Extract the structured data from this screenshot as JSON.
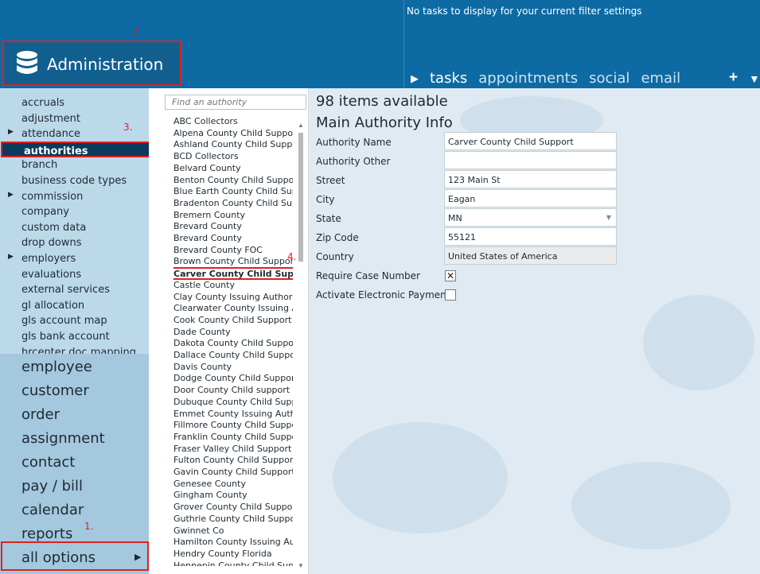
{
  "header": {
    "module_title": "Administration",
    "tasks_message": "No tasks to display for your current filter settings",
    "tabs": [
      "tasks",
      "appointments",
      "social",
      "email"
    ],
    "plus_label": "+",
    "caret_label": "▼",
    "play_label": "▶"
  },
  "annotations": {
    "n1": "1.",
    "n2": "2.",
    "n3": "3.",
    "n4": "4."
  },
  "sidebar": {
    "sub_items": [
      {
        "label": "accruals",
        "arrow": ""
      },
      {
        "label": "adjustment",
        "arrow": ""
      },
      {
        "label": "attendance",
        "arrow": "▶"
      },
      {
        "label": "authorities",
        "arrow": ""
      },
      {
        "label": "branch",
        "arrow": ""
      },
      {
        "label": "business code types",
        "arrow": ""
      },
      {
        "label": "commission",
        "arrow": "▶"
      },
      {
        "label": "company",
        "arrow": ""
      },
      {
        "label": "custom data",
        "arrow": ""
      },
      {
        "label": "drop downs",
        "arrow": ""
      },
      {
        "label": "employers",
        "arrow": "▶"
      },
      {
        "label": "evaluations",
        "arrow": ""
      },
      {
        "label": "external services",
        "arrow": ""
      },
      {
        "label": "gl allocation",
        "arrow": ""
      },
      {
        "label": "gls account map",
        "arrow": ""
      },
      {
        "label": "gls bank account",
        "arrow": ""
      },
      {
        "label": "hrcenter doc mapping",
        "arrow": ""
      }
    ],
    "selected_sub_item": "authorities",
    "main_nav": [
      "employee",
      "customer",
      "order",
      "assignment",
      "contact",
      "pay / bill",
      "calendar",
      "reports"
    ],
    "all_options": "all options",
    "all_options_arrow": "▶"
  },
  "list": {
    "search_placeholder": "Find an authority",
    "items": [
      "ABC Collectors",
      "Alpena County Child Support",
      "Ashland County Child Support",
      "BCD Collectors",
      "Belvard County",
      "Benton County Child Support",
      "Blue Earth County Child Support",
      "Bradenton County Child Support",
      "Bremern County",
      "Brevard County",
      "Brevard County",
      "Brevard County FOC",
      "Brown County Child Support",
      "Carver County Child Support",
      "Castle County",
      "Clay County Issuing Authority",
      "Clearwater County Issuing Authority",
      "Cook County Child Support Agency",
      "Dade County",
      "Dakota County Child Support Agency",
      "Dallace County Child Support",
      "Davis County",
      "Dodge County Child Support",
      "Door County Child support",
      "Dubuque County Child Support",
      "Emmet County Issuing Authority",
      "Fillmore County Child Support",
      "Franklin County Child Support",
      "Fraser Valley Child Support",
      "Fulton County Child Support",
      "Gavin County Child Support",
      "Genesee County",
      "Gingham County",
      "Grover County Child Support",
      "Guthrie County Child Support",
      "Gwinnet Co",
      "Hamilton County Issuing Authority",
      "Hendry County Florida",
      "Hennepin County Child Support"
    ],
    "selected_item": "Carver County Child Support",
    "scroll_up": "▲",
    "scroll_down": "▼"
  },
  "detail": {
    "items_available": "98 items available",
    "section_title": "Main Authority Info",
    "fields": {
      "authority_name": {
        "label": "Authority Name",
        "value": "Carver County Child Support"
      },
      "authority_other": {
        "label": "Authority Other",
        "value": ""
      },
      "street": {
        "label": "Street",
        "value": "123 Main St"
      },
      "city": {
        "label": "City",
        "value": "Eagan"
      },
      "state": {
        "label": "State",
        "value": "MN",
        "chevron": "▼"
      },
      "zip": {
        "label": "Zip Code",
        "value": "55121"
      },
      "country": {
        "label": "Country",
        "value": "United States of America"
      }
    },
    "require_case_number": {
      "label": "Require Case Number",
      "checked": true,
      "mark": "✕"
    },
    "activate_payments": {
      "label": "Activate Electronic Payments",
      "checked": false,
      "mark": ""
    }
  },
  "colors": {
    "header_bg": "#0d6aa3",
    "sidebar_bg": "#bcd9ea",
    "selected_bg": "#0b3a5c",
    "annotation_red": "#e02020"
  }
}
